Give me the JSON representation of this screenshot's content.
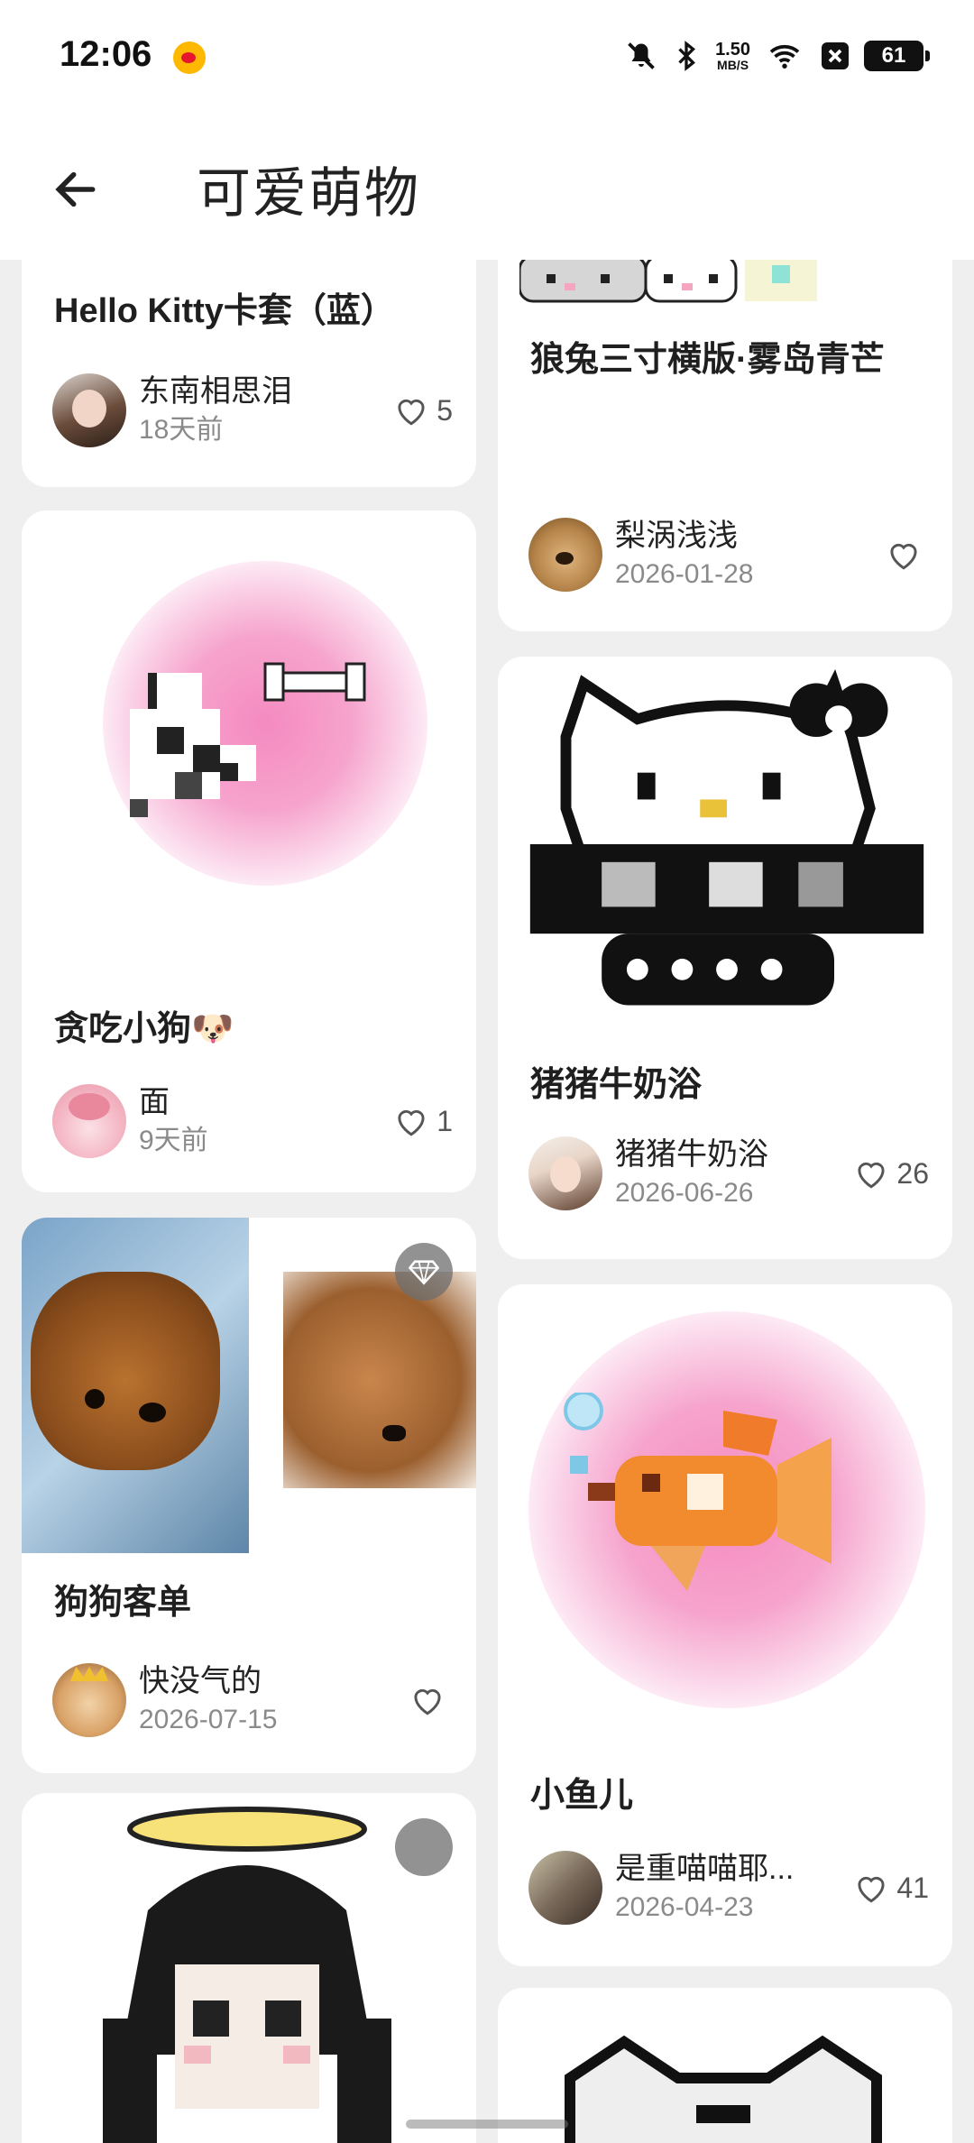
{
  "status_bar": {
    "time": "12:06",
    "net_speed_value": "1.50",
    "net_speed_unit": "MB/S",
    "battery": "61",
    "icons": [
      "weibo-icon",
      "mute-bell-icon",
      "bluetooth-icon",
      "wifi-icon",
      "x-box-icon",
      "battery-icon"
    ]
  },
  "app_bar": {
    "back_icon": "arrow-left-icon",
    "title": "可爱萌物"
  },
  "feed": {
    "left": [
      {
        "title": "Hello Kitty卡套（蓝）",
        "author": "东南相思泪",
        "date": "18天前",
        "likes": "5"
      },
      {
        "title": "贪吃小狗🐶",
        "author": "面",
        "date": "9天前",
        "likes": "1"
      },
      {
        "title": "狗狗客单",
        "author": "快没气的",
        "date": "2026-07-15",
        "likes": ""
      },
      {
        "title": "",
        "author": "",
        "date": "",
        "likes": ""
      }
    ],
    "right": [
      {
        "title": "狼兔三寸横版·雾岛青芒",
        "author": "梨涡浅浅",
        "date": "2026-01-28",
        "likes": ""
      },
      {
        "title": "猪猪牛奶浴",
        "author": "猪猪牛奶浴",
        "date": "2026-06-26",
        "likes": "26"
      },
      {
        "title": "小鱼儿",
        "author": "是重喵喵耶...",
        "date": "2026-04-23",
        "likes": "41"
      },
      {
        "title": "",
        "author": "",
        "date": "",
        "likes": ""
      }
    ]
  },
  "colors": {
    "background": "#efefef",
    "card": "#ffffff",
    "glow_pink": "#f58ac0",
    "muted_text": "#8a8a8a"
  }
}
